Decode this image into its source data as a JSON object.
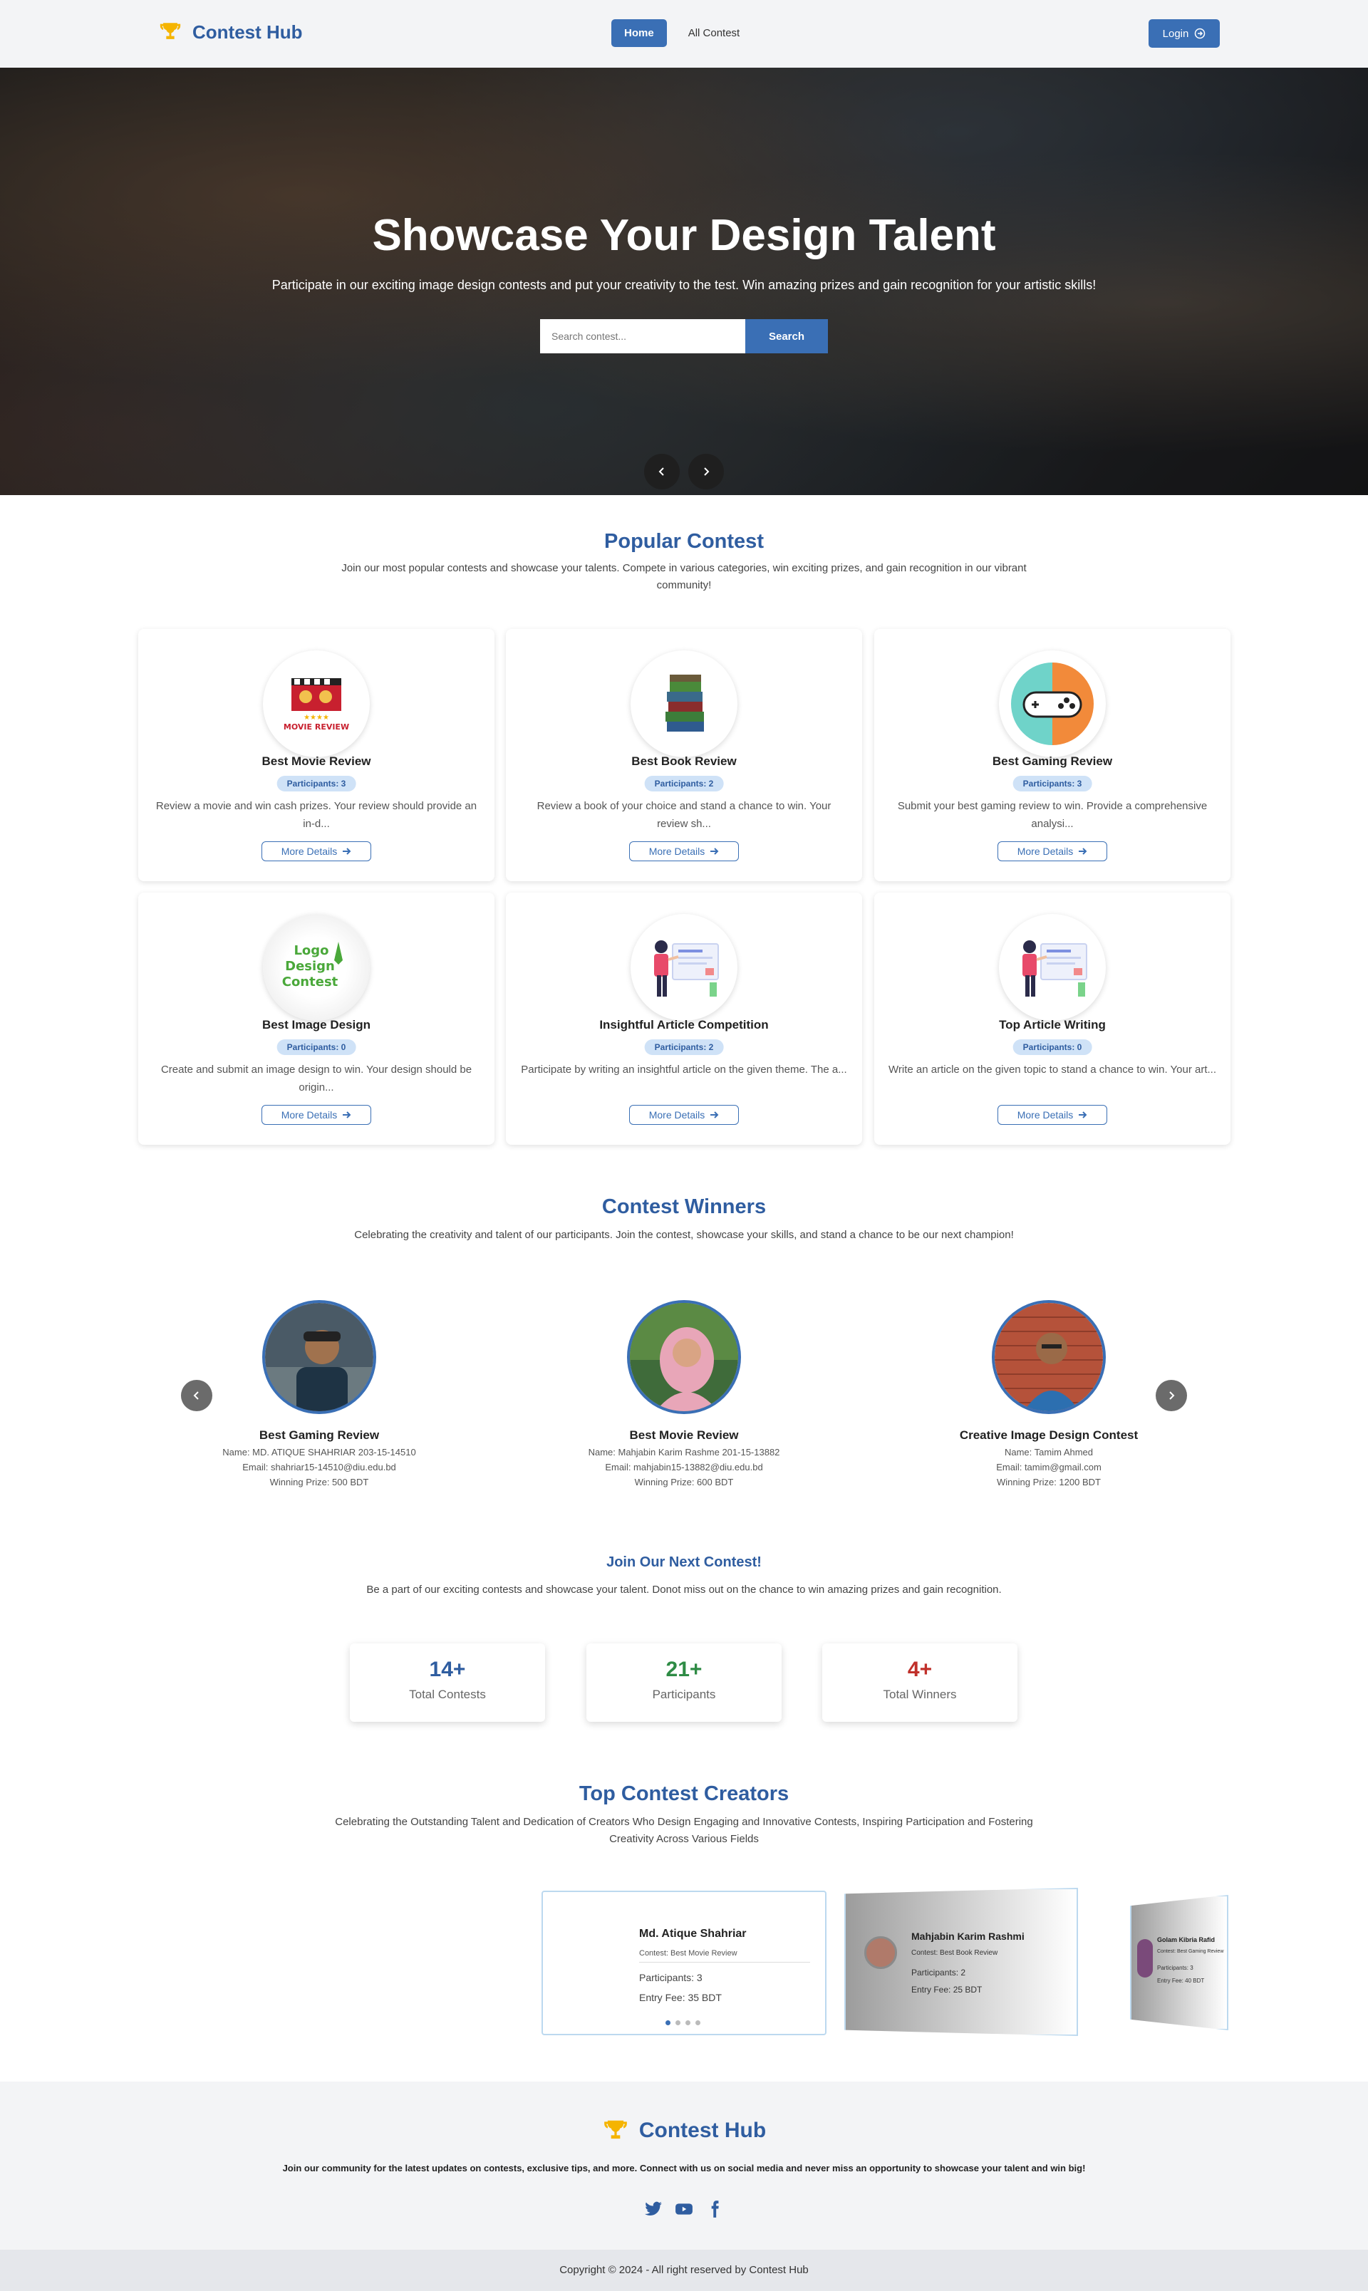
{
  "nav": {
    "brand": "Contest Hub",
    "links": [
      "Home",
      "All Contest"
    ],
    "login": "Login"
  },
  "hero": {
    "title": "Showcase Your Design Talent",
    "subtitle": "Participate in our exciting image design contests and put your creativity to the test. Win amazing prizes and gain recognition for your artistic skills!",
    "search_placeholder": "Search contest...",
    "search_button": "Search"
  },
  "popular": {
    "title": "Popular Contest",
    "desc": "Join our most popular contests and showcase your talents. Compete in various categories, win exciting prizes, and gain recognition in our vibrant community!",
    "more_label": "More Details",
    "cards": [
      {
        "title": "Best Movie Review",
        "participants": "Participants: 3",
        "desc": "Review a movie and win cash prizes. Your review should provide an in-d...",
        "icon": "movie-review-icon"
      },
      {
        "title": "Best Book Review",
        "participants": "Participants: 2",
        "desc": "Review a book of your choice and stand a chance to win. Your review sh...",
        "icon": "books-icon"
      },
      {
        "title": "Best Gaming Review",
        "participants": "Participants: 3",
        "desc": "Submit your best gaming review to win. Provide a comprehensive analysi...",
        "icon": "gamepad-icon"
      },
      {
        "title": "Best Image Design",
        "participants": "Participants: 0",
        "desc": "Create and submit an image design to win. Your design should be origin...",
        "icon": "logo-design-icon",
        "image_text": "Logo Design Contest"
      },
      {
        "title": "Insightful Article Competition",
        "participants": "Participants: 2",
        "desc": "Participate by writing an insightful article on the given theme. The a...",
        "icon": "article-writer-icon"
      },
      {
        "title": "Top Article Writing",
        "participants": "Participants: 0",
        "desc": "Write an article on the given topic to stand a chance to win. Your art...",
        "icon": "article-writer-icon"
      }
    ]
  },
  "winners": {
    "title": "Contest Winners",
    "desc": "Celebrating the creativity and talent of our participants. Join the contest, showcase your skills, and stand a chance to be our next champion!",
    "items": [
      {
        "title": "Best Gaming Review",
        "name": "Name: MD. ATIQUE SHAHRIAR 203-15-14510",
        "email": "Email: shahriar15-14510@diu.edu.bd",
        "prize": "Winning Prize: 500 BDT"
      },
      {
        "title": "Best Movie Review",
        "name": "Name: Mahjabin Karim Rashme 201-15-13882",
        "email": "Email: mahjabin15-13882@diu.edu.bd",
        "prize": "Winning Prize: 600 BDT"
      },
      {
        "title": "Creative Image Design Contest",
        "name": "Name: Tamim Ahmed",
        "email": "Email: tamim@gmail.com",
        "prize": "Winning Prize: 1200 BDT"
      }
    ]
  },
  "join": {
    "title": "Join Our Next Contest!",
    "desc": "Be a part of our exciting contests and showcase your talent. Donot miss out on the chance to win amazing prizes and gain recognition.",
    "stats": [
      {
        "value": "14+",
        "label": "Total Contests",
        "color": "#2f5da0"
      },
      {
        "value": "21+",
        "label": "Participants",
        "color": "#2e8b45"
      },
      {
        "value": "4+",
        "label": "Total Winners",
        "color": "#c0302a"
      }
    ]
  },
  "creators": {
    "title": "Top Contest Creators",
    "desc": "Celebrating the Outstanding Talent and Dedication of Creators Who Design Engaging and Innovative Contests, Inspiring Participation and Fostering Creativity Across Various Fields",
    "active": {
      "name": "Md. Atique Shahriar",
      "contest": "Contest: Best Movie Review",
      "participants": "Participants: 3",
      "fee": "Entry Fee: 35 BDT"
    },
    "next": {
      "name": "Mahjabin Karim Rashmi",
      "contest": "Contest: Best Book Review",
      "participants": "Participants: 2",
      "fee": "Entry Fee: 25 BDT"
    },
    "third": {
      "name": "Golam Kibria Rafid",
      "contest": "Contest: Best Gaming Review",
      "participants": "Participants: 3",
      "fee": "Entry Fee: 40 BDT"
    }
  },
  "footer": {
    "brand": "Contest Hub",
    "text": "Join our community for the latest updates on contests, exclusive tips, and more. Connect with us on social media and never miss an opportunity to showcase your talent and win big!",
    "copyright": "Copyright © 2024 - All right reserved by Contest Hub"
  },
  "colors": {
    "primary": "#3a6fb5",
    "heading": "#2f5da0",
    "trophy": "#f5b400"
  }
}
